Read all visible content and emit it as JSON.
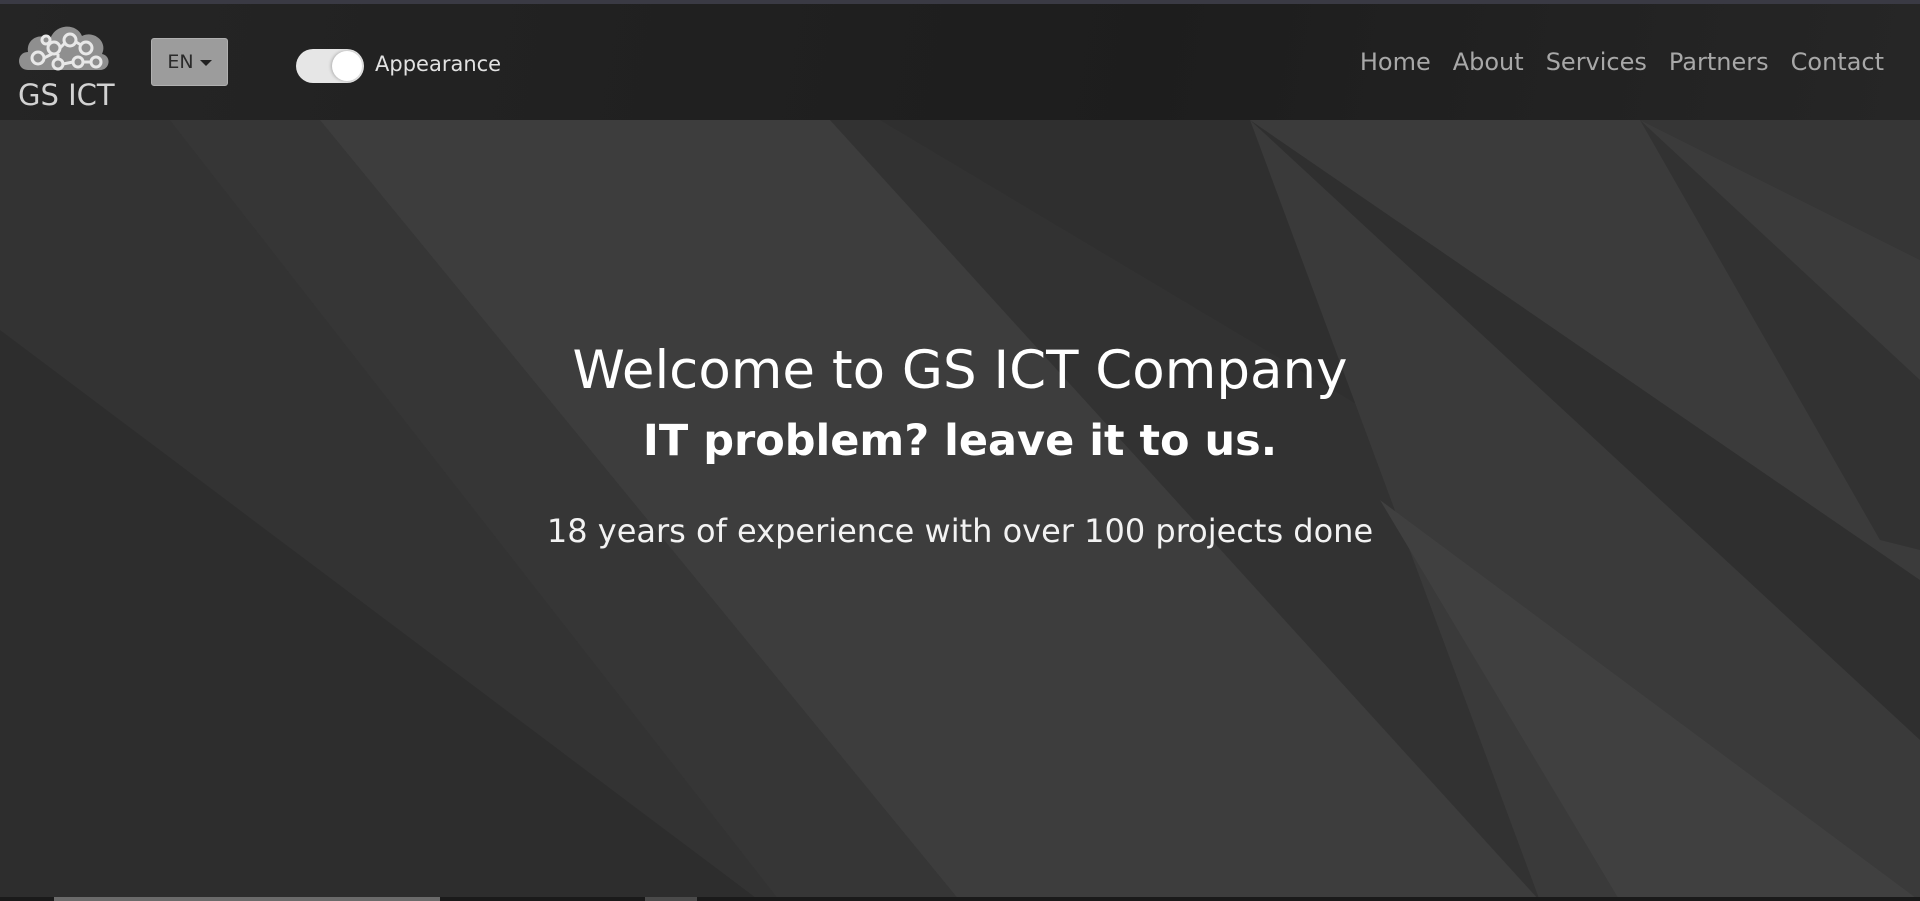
{
  "brand": {
    "logo_text": "GS ICT",
    "logo_icon": "cloud-network-icon"
  },
  "language": {
    "selected": "EN"
  },
  "appearance": {
    "label": "Appearance",
    "enabled": true
  },
  "nav": {
    "items": [
      {
        "label": "Home"
      },
      {
        "label": "About"
      },
      {
        "label": "Services"
      },
      {
        "label": "Partners"
      },
      {
        "label": "Contact"
      }
    ]
  },
  "hero": {
    "title": "Welcome to GS ICT Company",
    "subtitle": "IT problem? leave it to us.",
    "text": "18 years of experience with over 100 projects done"
  },
  "colors": {
    "navbar_bg": "#1f1f1f",
    "hero_bg": "#353535",
    "nav_link": "#a8a8a8",
    "toggle_on": "#e6e6e6"
  }
}
